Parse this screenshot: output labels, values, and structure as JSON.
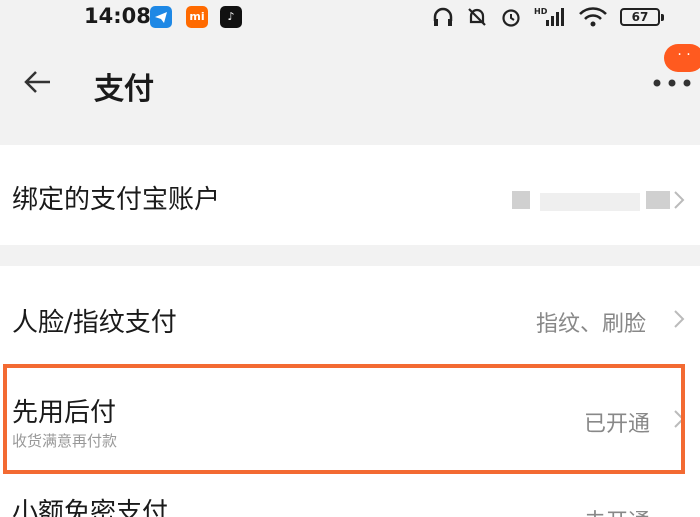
{
  "status_bar": {
    "time": "14:08",
    "app_icons": [
      "telegram-icon",
      "mi-icon",
      "tiktok-icon"
    ],
    "app_icon_labels": {
      "mi": "mi",
      "tiktok": "♪"
    },
    "system_icons": [
      "headphones-icon",
      "mute-bell-icon",
      "alarm-icon",
      "hd-signal-icon",
      "wifi-icon"
    ],
    "hd_label": "HD",
    "battery": "67"
  },
  "header": {
    "title": "支付",
    "notification_badge": "· ·"
  },
  "rows": [
    {
      "label": "绑定的支付宝账户",
      "value": ""
    },
    {
      "label": "人脸/指纹支付",
      "value": "指纹、刷脸"
    },
    {
      "label": "先用后付",
      "subtitle": "收货满意再付款",
      "value": "已开通"
    },
    {
      "label": "小额免密支付",
      "value": "未开通"
    }
  ],
  "colors": {
    "accent": "#f36a32",
    "badge": "#ff5a1f"
  }
}
